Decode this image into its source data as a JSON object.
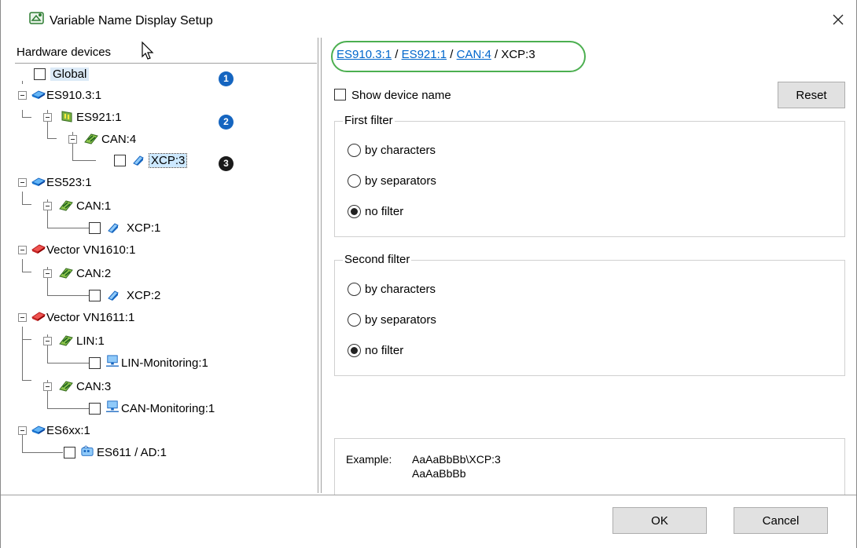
{
  "window": {
    "title": "Variable Name Display Setup",
    "close_label": "×"
  },
  "left": {
    "header": "Hardware devices",
    "tree": {
      "global": "Global",
      "es910": "ES910.3:1",
      "es921": "ES921:1",
      "can4": "CAN:4",
      "xcp3": "XCP:3",
      "es523": "ES523:1",
      "can1": "CAN:1",
      "xcp1": "XCP:1",
      "vn1610": "Vector VN1610:1",
      "can2": "CAN:2",
      "xcp2": "XCP:2",
      "vn1611": "Vector VN1611:1",
      "lin1": "LIN:1",
      "lin_mon": "LIN-Monitoring:1",
      "can3": "CAN:3",
      "can_mon": "CAN-Monitoring:1",
      "es6xx": "ES6xx:1",
      "es611": "ES611 / AD:1"
    },
    "badges": [
      "1",
      "2",
      "3"
    ]
  },
  "right": {
    "breadcrumb": {
      "items": [
        "ES910.3:1",
        "ES921:1",
        "CAN:4"
      ],
      "current": "XCP:3",
      "separator": "/"
    },
    "show_device_name": "Show device name",
    "reset_label": "Reset",
    "first_filter": {
      "title": "First filter",
      "options": [
        "by characters",
        "by separators",
        "no filter"
      ],
      "selected": "no filter"
    },
    "second_filter": {
      "title": "Second filter",
      "options": [
        "by characters",
        "by separators",
        "no filter"
      ],
      "selected": "no filter"
    },
    "example": {
      "label": "Example:",
      "line1": "AaAaBbBb\\XCP:3",
      "line2": "AaAaBbBb"
    }
  },
  "buttons": {
    "ok": "OK",
    "cancel": "Cancel"
  },
  "colors": {
    "link": "#0066cc",
    "highlight_oval": "#4caf50",
    "badge_blue": "#1565c0",
    "selection": "#cce8ff"
  }
}
